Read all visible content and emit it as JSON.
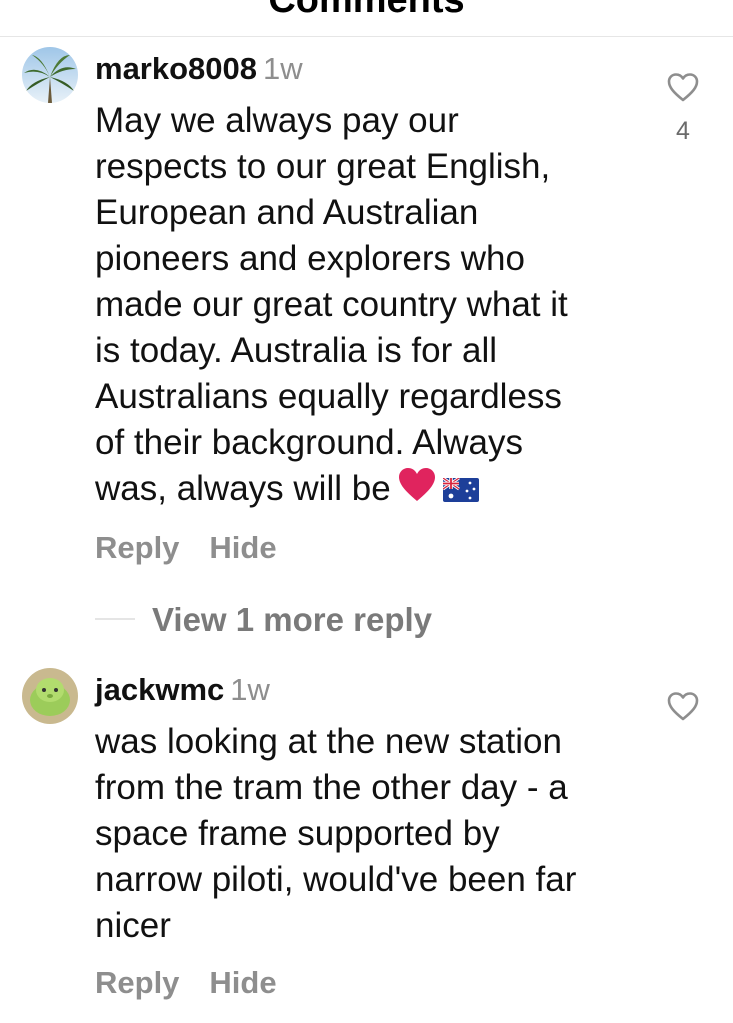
{
  "header": {
    "title": "Comments"
  },
  "comments": [
    {
      "username": "marko8008",
      "time": "1w",
      "avatar": "palm-tree-avatar",
      "text": "May we always pay our\nrespects to our great English,\nEuropean and Australian\npioneers and explorers who\nmade our great country what it\nis today. Australia is for all\nAustralians equally regardless\nof their background. Always\nwas, always will be",
      "emojis": [
        "red-heart-emoji",
        "australian-flag-emoji"
      ],
      "likes": "4",
      "reply_label": "Reply",
      "hide_label": "Hide",
      "view_replies_label": "View 1 more reply"
    },
    {
      "username": "jackwmc",
      "time": "1w",
      "avatar": "green-creature-avatar",
      "text": "was looking at the new station\nfrom the tram the other day - a\nspace frame supported by\nnarrow piloti, would've been far\nnicer",
      "reply_label": "Reply",
      "hide_label": "Hide"
    }
  ],
  "colors": {
    "secondary_text": "#8e8e8e",
    "heart_red": "#e0245e",
    "divider": "#e6e6e6"
  }
}
